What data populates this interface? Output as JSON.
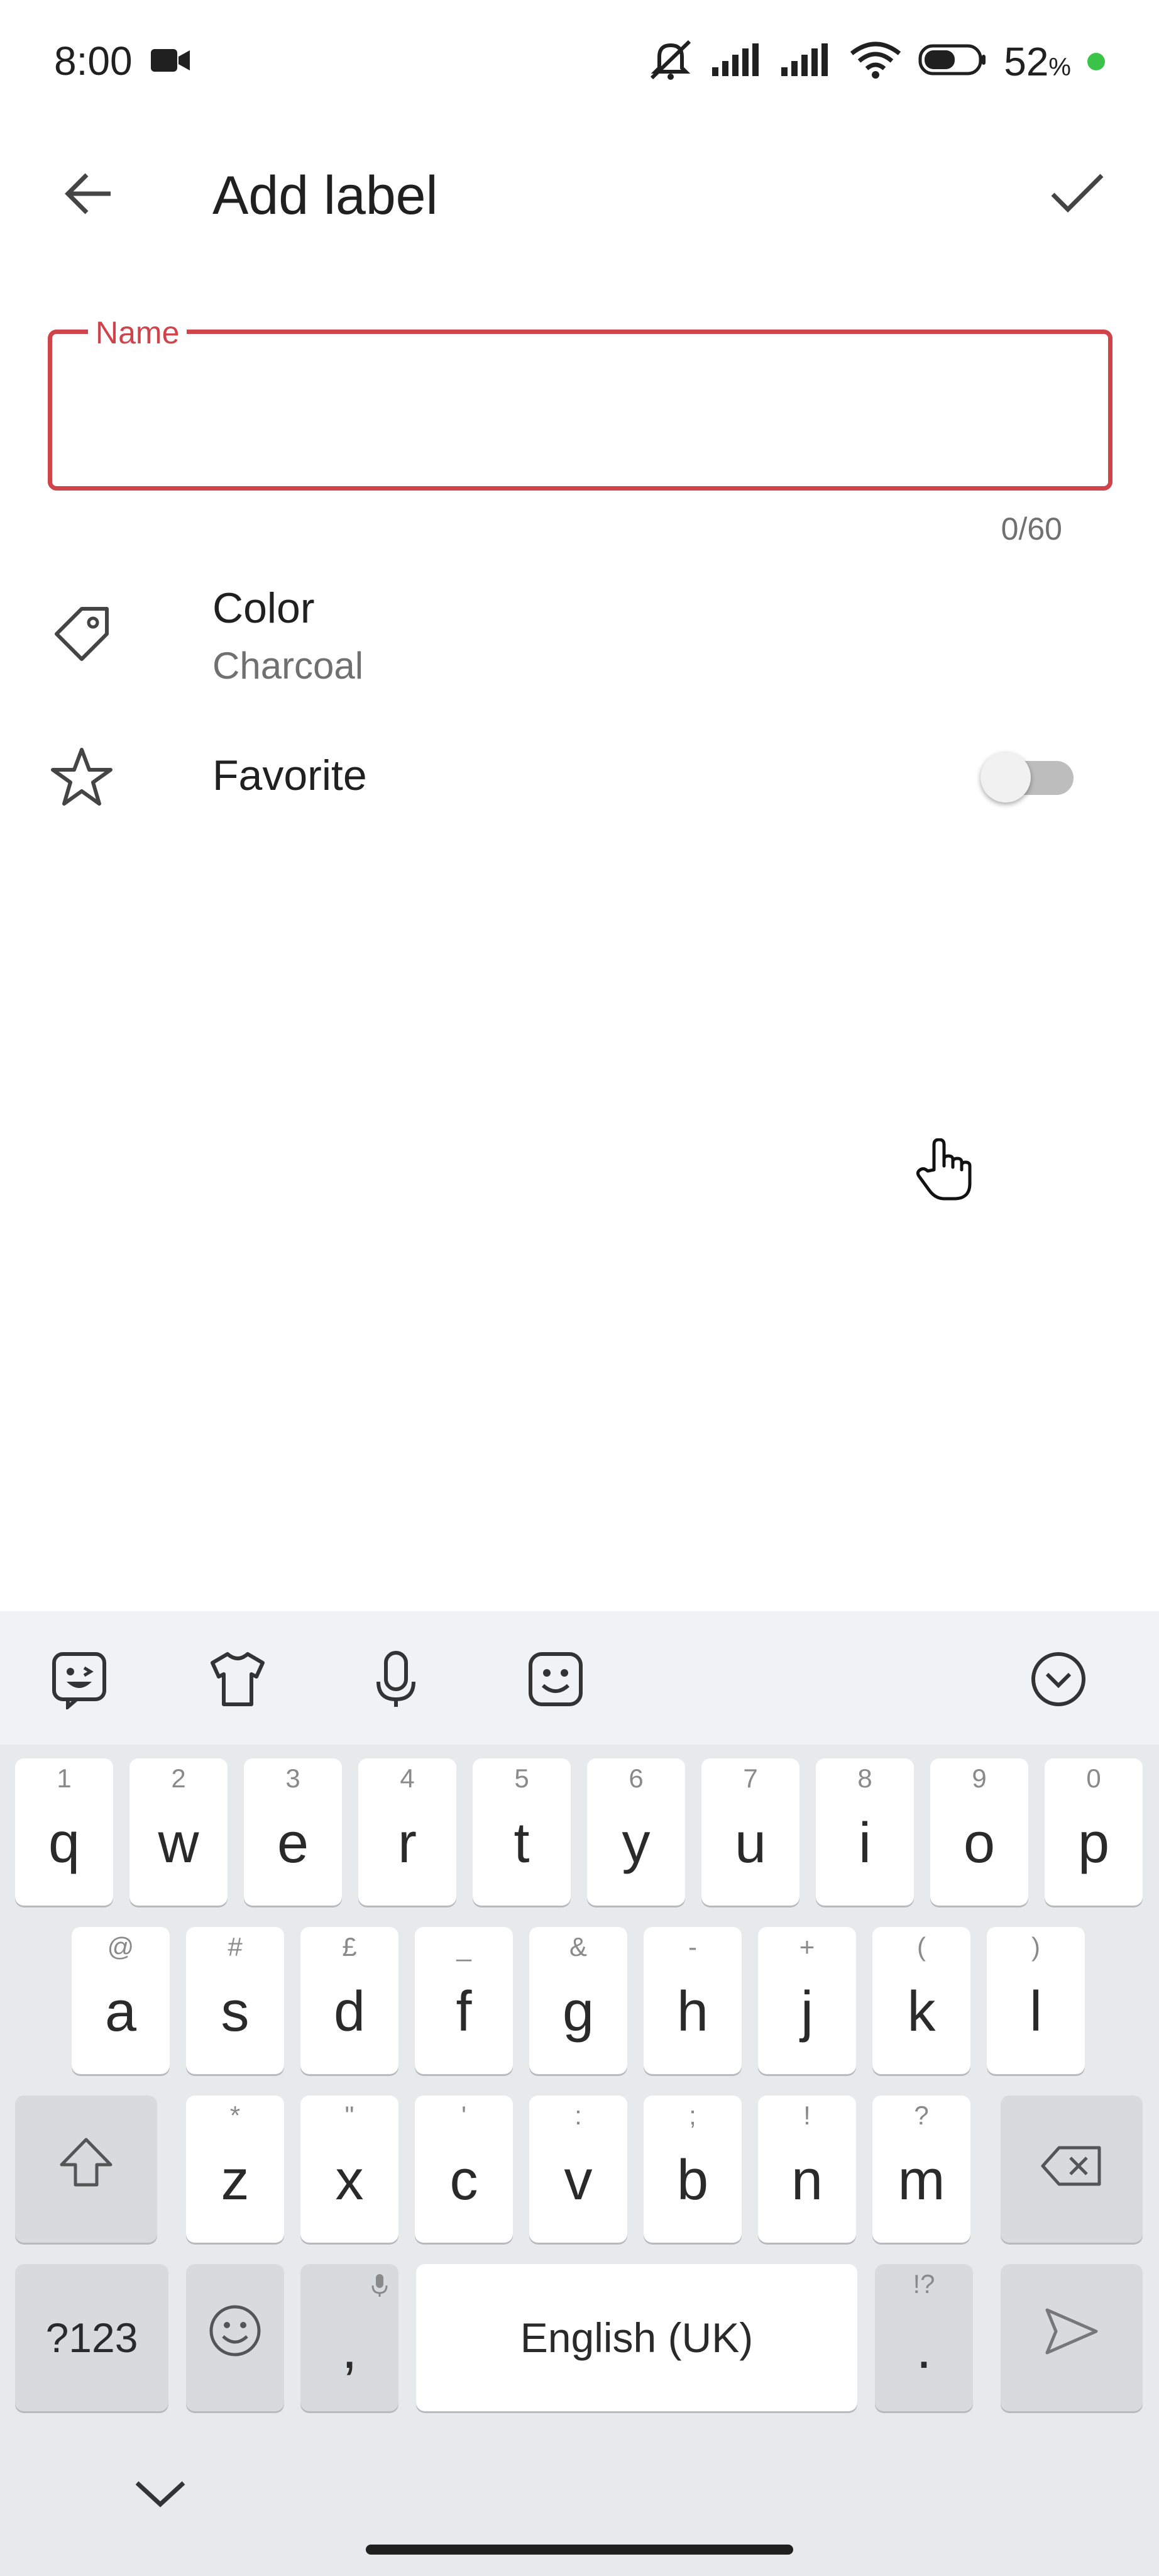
{
  "status_bar": {
    "time": "8:00",
    "battery": "52",
    "battery_unit": "%",
    "icons": [
      "video-camera-icon",
      "mute-bell-icon",
      "signal-icon",
      "signal-icon",
      "wifi-icon",
      "battery-icon"
    ]
  },
  "header": {
    "title": "Add label",
    "back_icon": "arrow-left-icon",
    "confirm_icon": "check-icon"
  },
  "name_field": {
    "label": "Name",
    "value": "",
    "counter": "0/60"
  },
  "color_row": {
    "title": "Color",
    "value": "Charcoal",
    "icon": "tag-icon"
  },
  "favorite_row": {
    "title": "Favorite",
    "icon": "star-icon",
    "enabled": false
  },
  "keyboard": {
    "toolbar": [
      "sticker-icon",
      "theme-shirt-icon",
      "microphone-icon",
      "emoji-face-icon",
      "collapse-keyboard-icon"
    ],
    "row1": [
      {
        "key": "q",
        "hint": "1"
      },
      {
        "key": "w",
        "hint": "2"
      },
      {
        "key": "e",
        "hint": "3"
      },
      {
        "key": "r",
        "hint": "4"
      },
      {
        "key": "t",
        "hint": "5"
      },
      {
        "key": "y",
        "hint": "6"
      },
      {
        "key": "u",
        "hint": "7"
      },
      {
        "key": "i",
        "hint": "8"
      },
      {
        "key": "o",
        "hint": "9"
      },
      {
        "key": "p",
        "hint": "0"
      }
    ],
    "row2": [
      {
        "key": "a",
        "hint": "@"
      },
      {
        "key": "s",
        "hint": "#"
      },
      {
        "key": "d",
        "hint": "£"
      },
      {
        "key": "f",
        "hint": "_"
      },
      {
        "key": "g",
        "hint": "&"
      },
      {
        "key": "h",
        "hint": "-"
      },
      {
        "key": "j",
        "hint": "+"
      },
      {
        "key": "k",
        "hint": "("
      },
      {
        "key": "l",
        "hint": ")"
      }
    ],
    "row3": [
      {
        "key": "z",
        "hint": "*"
      },
      {
        "key": "x",
        "hint": "\""
      },
      {
        "key": "c",
        "hint": "'"
      },
      {
        "key": "v",
        "hint": ":"
      },
      {
        "key": "b",
        "hint": ";"
      },
      {
        "key": "n",
        "hint": "!"
      },
      {
        "key": "m",
        "hint": "?"
      }
    ],
    "symbols_key": "?123",
    "comma_key": ",",
    "space_label": "English (UK)",
    "period_key": ".",
    "period_hint": "!?"
  }
}
